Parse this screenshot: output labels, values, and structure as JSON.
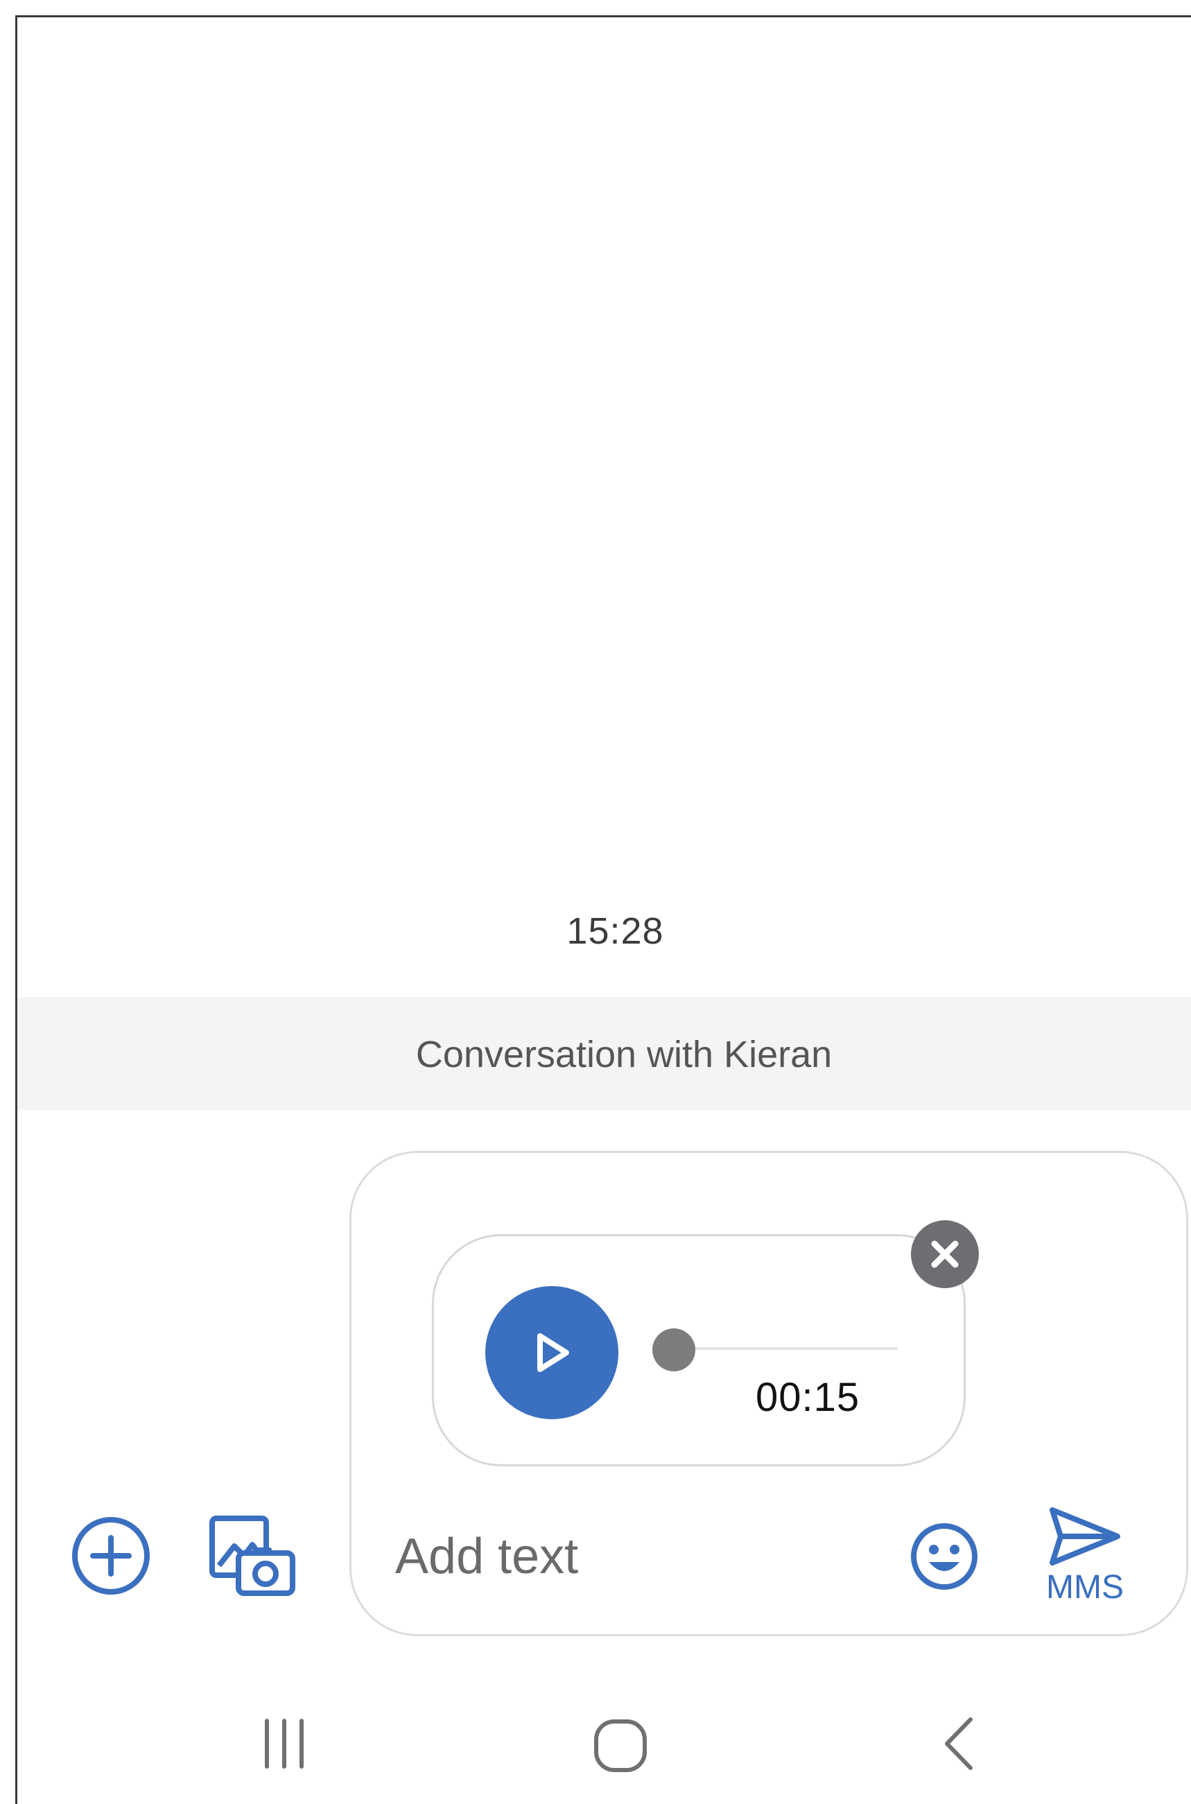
{
  "conversation": {
    "timestamp": "15:28",
    "banner": "Conversation with Kieran"
  },
  "attachment": {
    "type": "audio",
    "duration": "00:15",
    "progress": 0,
    "play_icon": "play-icon",
    "remove_icon": "close-icon"
  },
  "composer": {
    "placeholder": "Add text",
    "send_label": "MMS",
    "icons": {
      "add": "plus-circle-icon",
      "gallery": "gallery-camera-icon",
      "emoji": "smiley-icon",
      "send": "send-icon"
    }
  },
  "navbar": {
    "icons": [
      "recents-icon",
      "home-icon",
      "back-icon"
    ]
  },
  "colors": {
    "accent": "#3b6fbf",
    "banner_bg": "#f4f4f4",
    "knob": "#7d7d80",
    "close_bg": "#6e6e72"
  }
}
